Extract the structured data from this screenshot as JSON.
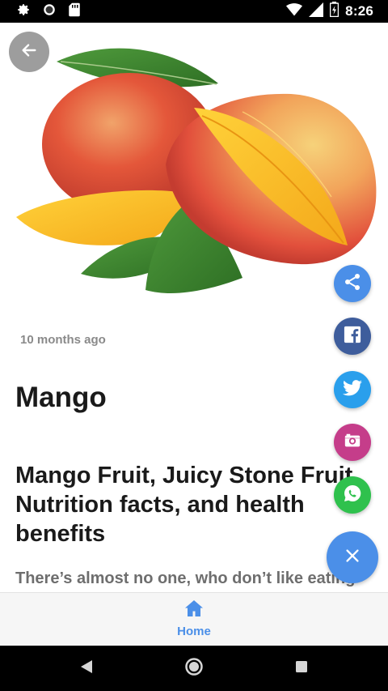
{
  "status_bar": {
    "time": "8:26",
    "left_icons": [
      "gear-icon",
      "circle-icon",
      "sd-card-icon"
    ],
    "right_icons": [
      "wifi-icon",
      "cell-signal-icon",
      "battery-icon"
    ]
  },
  "article": {
    "image_alt": "Mango fruit",
    "time_ago": "10 months ago",
    "category": "Mango",
    "headline": "Mango Fruit, Juicy Stone Fruit Nutrition facts, and health benefits",
    "excerpt": "There’s almost no one, who don’t like eating"
  },
  "fabs": [
    {
      "name": "share",
      "icon": "share-icon",
      "color": "#4b8fe8"
    },
    {
      "name": "facebook",
      "icon": "facebook-icon",
      "color": "#3e5d9c"
    },
    {
      "name": "twitter",
      "icon": "twitter-icon",
      "color": "#2a9fec"
    },
    {
      "name": "instagram",
      "icon": "instagram-icon",
      "color": "#c53d8a"
    },
    {
      "name": "whatsapp",
      "icon": "whatsapp-icon",
      "color": "#2fc14d"
    },
    {
      "name": "close",
      "icon": "close-icon",
      "color": "#4b8fe8"
    }
  ],
  "bottom_nav": {
    "home_label": "Home",
    "home_icon": "home-icon",
    "accent": "#4b8fe8"
  },
  "system_nav": [
    "back-icon",
    "home-circle-icon",
    "recents-icon"
  ]
}
